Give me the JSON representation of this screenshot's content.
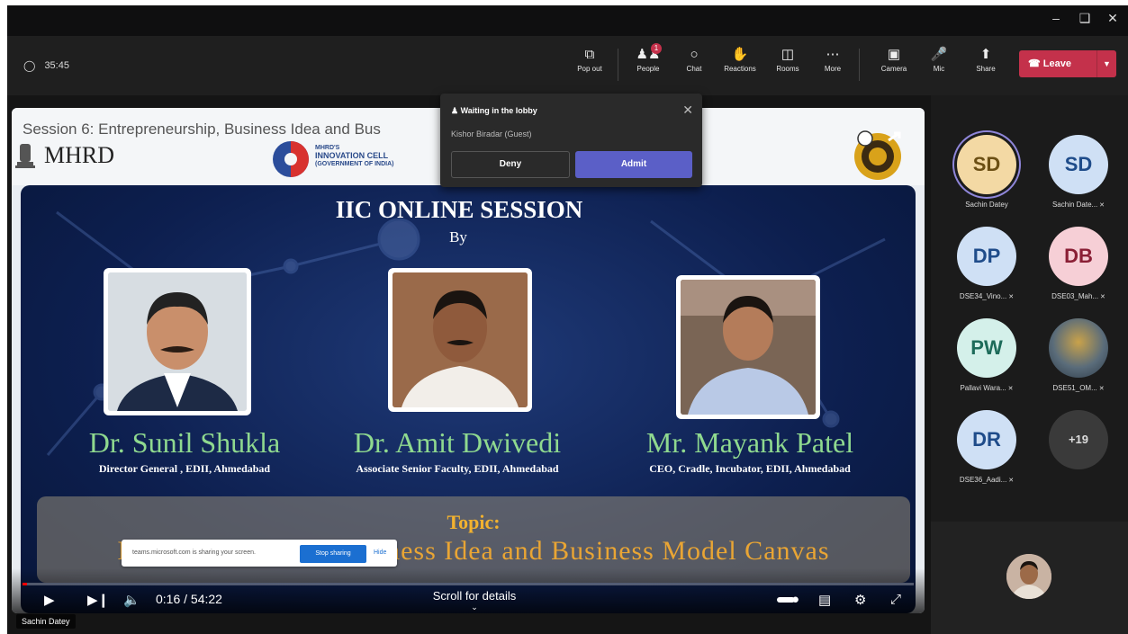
{
  "window": {
    "minimize_icon": "minimize-icon",
    "restore_icon": "restore-icon",
    "close_icon": "close-icon"
  },
  "toolbar": {
    "timer": "35:45",
    "buttons": {
      "popout": "Pop out",
      "people": "People",
      "people_badge": "1",
      "chat": "Chat",
      "reactions": "Reactions",
      "rooms": "Rooms",
      "more": "More",
      "camera": "Camera",
      "mic": "Mic",
      "share": "Share"
    },
    "leave": "Leave",
    "leave_color": "#c4314b"
  },
  "lobby": {
    "title": "Waiting in the lobby",
    "guest": "Kishor Biradar (Guest)",
    "deny": "Deny",
    "admit": "Admit",
    "admit_color": "#5b5fc7"
  },
  "slide": {
    "session_title": "Session 6: Entrepreneurship, Business Idea and Bus",
    "mhrd": "MHRD",
    "iic_logo_text": [
      "MHRD'S",
      "INNOVATION CELL",
      "(GOVERNMENT OF INDIA)"
    ],
    "heading": "IIC ONLINE SESSION",
    "by": "By",
    "speakers": [
      {
        "name": "Dr. Sunil Shukla",
        "role": "Director General , EDII, Ahmedabad"
      },
      {
        "name": "Dr. Amit Dwivedi",
        "role": "Associate Senior Faculty, EDII, Ahmedabad"
      },
      {
        "name": "Mr. Mayank Patel",
        "role": "CEO, Cradle, Incubator, EDII, Ahmedabad"
      }
    ],
    "topic_label": "Topic:",
    "topic": "Entrepreneurship, Business Idea and Business Model Canvas"
  },
  "share_banner": {
    "message": "teams.microsoft.com is sharing your screen.",
    "stop": "Stop sharing",
    "hide": "Hide"
  },
  "player": {
    "time": "0:16 / 54:22",
    "progress": 0.005,
    "scroll_hint": "Scroll for details"
  },
  "presenter_tag": "Sachin Datey",
  "participants": [
    {
      "initials": "SD",
      "name": "Sachin Datey",
      "bg": "#f3d9a4",
      "fg": "#6b4f14",
      "ring": true,
      "muted": false
    },
    {
      "initials": "SD",
      "name": "Sachin Date...",
      "bg": "#cfe0f5",
      "fg": "#1f4c8a",
      "ring": false,
      "muted": true
    },
    {
      "initials": "DP",
      "name": "DSE34_Vino...",
      "bg": "#cfe0f5",
      "fg": "#1f4c8a",
      "ring": false,
      "muted": true
    },
    {
      "initials": "DB",
      "name": "DSE03_Mah...",
      "bg": "#f6cfd6",
      "fg": "#8a1f35",
      "ring": false,
      "muted": true
    },
    {
      "initials": "PW",
      "name": "Pallavi Wara...",
      "bg": "#d4f0ea",
      "fg": "#1d6b5a",
      "ring": false,
      "muted": true
    },
    {
      "initials": "",
      "name": "DSE51_OM...",
      "bg": "#3a4a5a",
      "fg": "#fff",
      "ring": false,
      "muted": true
    },
    {
      "initials": "DR",
      "name": "DSE36_Aadi...",
      "bg": "#cfe0f5",
      "fg": "#1f4c8a",
      "ring": false,
      "muted": true
    },
    {
      "initials": "+19",
      "name": "",
      "bg": "#3a3a3a",
      "fg": "#ddd",
      "ring": false,
      "muted": false
    }
  ]
}
